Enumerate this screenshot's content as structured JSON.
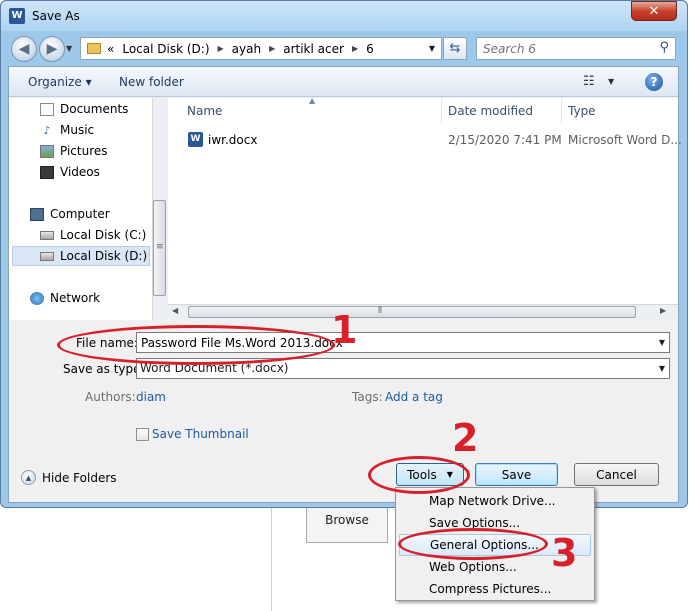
{
  "window": {
    "title": "Save As",
    "app_icon_letter": "W",
    "close_label": "✕"
  },
  "address": {
    "crumbs": [
      "«",
      "Local Disk (D:)",
      "ayah",
      "artikl acer",
      "6"
    ],
    "search_placeholder": "Search 6"
  },
  "toolbar": {
    "organize_label": "Organize ▾",
    "new_folder_label": "New folder",
    "help_label": "?"
  },
  "nav": {
    "items": [
      {
        "label": "Documents",
        "icon": "documents-icon"
      },
      {
        "label": "Music",
        "icon": "music-icon"
      },
      {
        "label": "Pictures",
        "icon": "pictures-icon"
      },
      {
        "label": "Videos",
        "icon": "videos-icon"
      },
      {
        "label": "Computer",
        "icon": "computer-icon"
      },
      {
        "label": "Local Disk (C:)",
        "icon": "drive-icon"
      },
      {
        "label": "Local Disk (D:)",
        "icon": "drive-icon"
      },
      {
        "label": "Network",
        "icon": "network-icon"
      }
    ],
    "selected": "Local Disk (D:)"
  },
  "files": {
    "columns": [
      "Name",
      "Date modified",
      "Type"
    ],
    "rows": [
      {
        "name": "iwr.docx",
        "date": "2/15/2020 7:41 PM",
        "type": "Microsoft Word D..."
      }
    ]
  },
  "form": {
    "filename_label": "File name:",
    "filename_value": "Password File Ms.Word 2013.docx",
    "savetype_label": "Save as type:",
    "savetype_value": "Word Document (*.docx)",
    "authors_label": "Authors:",
    "authors_value": "diam",
    "tags_label": "Tags:",
    "tags_value": "Add a tag",
    "thumbnail_label": "Save Thumbnail"
  },
  "footer": {
    "hide_folders_label": "Hide Folders",
    "tools_label": "Tools",
    "save_label": "Save",
    "cancel_label": "Cancel"
  },
  "tools_menu": {
    "items": [
      "Map Network Drive...",
      "Save Options...",
      "General Options...",
      "Web Options...",
      "Compress Pictures..."
    ],
    "highlighted": "General Options..."
  },
  "background": {
    "browse_label": "Browse"
  },
  "annotations": [
    "1",
    "2",
    "3"
  ],
  "colors": {
    "annotation": "#d8202a",
    "link": "#1f5aa8",
    "frame": "#9ec8ea"
  }
}
